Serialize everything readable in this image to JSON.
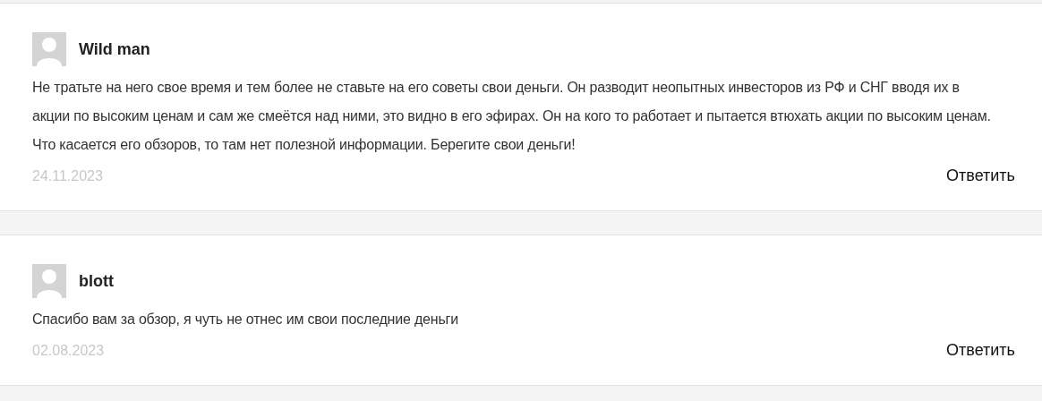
{
  "comments": [
    {
      "author": "Wild man",
      "text": "Не тратьте на него свое время и тем более не ставьте на его советы свои деньги. Он разводит неопытных инвесторов из РФ и СНГ вводя их в акции по высоким ценам и сам же смеётся над ними, это видно в его эфирах. Он на кого то работает и пытается втюхать акции по высоким ценам. Что касается его обзоров, то там нет полезной информации. Берегите свои деньги!",
      "date": "24.11.2023",
      "reply": "Ответить"
    },
    {
      "author": "blott",
      "text": "Спасибо вам за обзор, я чуть не отнес им свои последние деньги",
      "date": "02.08.2023",
      "reply": "Ответить"
    }
  ]
}
